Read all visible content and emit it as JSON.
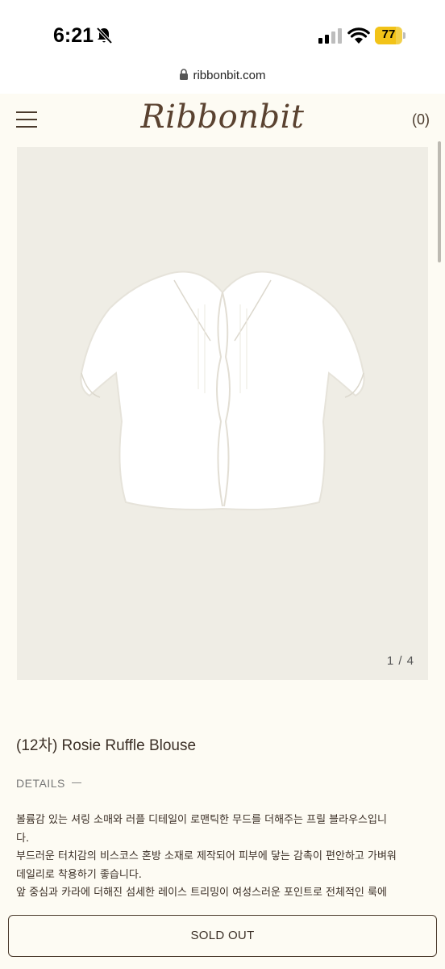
{
  "status_bar": {
    "time": "6:21",
    "battery_level": "77",
    "icons": [
      "bell-slash-icon",
      "signal-icon",
      "wifi-icon",
      "battery-icon"
    ]
  },
  "browser": {
    "url": "ribbonbit.com",
    "lock_icon": "lock-icon"
  },
  "header": {
    "logo_text": "Ribbonbit",
    "cart_label": "(0)",
    "menu_icon": "hamburger-menu-icon"
  },
  "product": {
    "image_counter": "1 / 4",
    "title": "(12차) Rosie Ruffle Blouse",
    "details_label": "DETAILS",
    "description_lines": [
      "볼륨감 있는 셔링 소매와 러플 디테일이 로맨틱한 무드를 더해주는 프릴 블라우스입니",
      "다.",
      "부드러운 터치감의 비스코스 혼방 소재로 제작되어 피부에 닿는 감촉이 편안하고 가벼워",
      "데일리로 착용하기 좋습니다.",
      "앞 중심과 카라에 더해진 섬세한 레이스 트리밍이 여성스러운 포인트로 전체적인 룩에"
    ]
  },
  "actions": {
    "sold_out_label": "SOLD OUT"
  },
  "colors": {
    "background": "#fdfbf3",
    "image_background": "#efede5",
    "text": "#3b2f26",
    "battery": "#f2d04a"
  }
}
